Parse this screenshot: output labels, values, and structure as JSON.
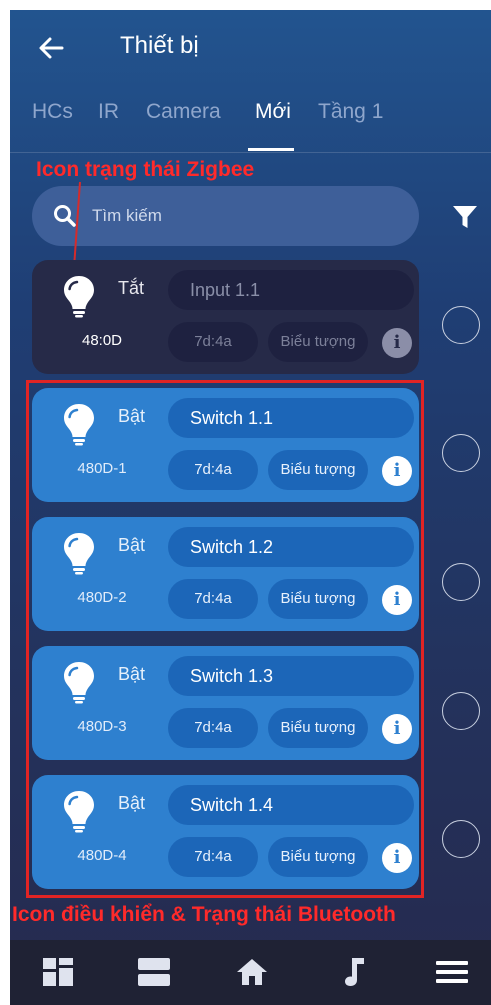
{
  "header": {
    "title": "Thiết bị"
  },
  "tabs": [
    {
      "label": "HCs"
    },
    {
      "label": "IR"
    },
    {
      "label": "Camera"
    },
    {
      "label": "Mới"
    },
    {
      "label": "Tầng 1"
    }
  ],
  "active_tab": "Mới",
  "search": {
    "placeholder": "Tìm kiếm"
  },
  "annotations": {
    "top": "Icon trạng thái Zigbee",
    "bottom": "Icon điều khiển & Trạng thái Bluetooth"
  },
  "devices": [
    {
      "state": "Tắt",
      "address": "48:0D",
      "name": "Input 1.1",
      "code": "7d:4a",
      "icon_label": "Biểu tượng",
      "on": false
    },
    {
      "state": "Bật",
      "address": "480D-1",
      "name": "Switch 1.1",
      "code": "7d:4a",
      "icon_label": "Biểu tượng",
      "on": true
    },
    {
      "state": "Bật",
      "address": "480D-2",
      "name": "Switch 1.2",
      "code": "7d:4a",
      "icon_label": "Biểu tượng",
      "on": true
    },
    {
      "state": "Bật",
      "address": "480D-3",
      "name": "Switch 1.3",
      "code": "7d:4a",
      "icon_label": "Biểu tượng",
      "on": true
    },
    {
      "state": "Bật",
      "address": "480D-4",
      "name": "Switch 1.4",
      "code": "7d:4a",
      "icon_label": "Biểu tượng",
      "on": true
    }
  ],
  "info_glyph": "i",
  "colors": {
    "annotation": "#ff2a2a",
    "card_on": "#2e80cf",
    "card_off": "#262a48"
  },
  "navbar": [
    {
      "icon": "dashboard-icon"
    },
    {
      "icon": "rooms-icon"
    },
    {
      "icon": "home-icon"
    },
    {
      "icon": "music-icon"
    },
    {
      "icon": "menu-icon"
    }
  ]
}
